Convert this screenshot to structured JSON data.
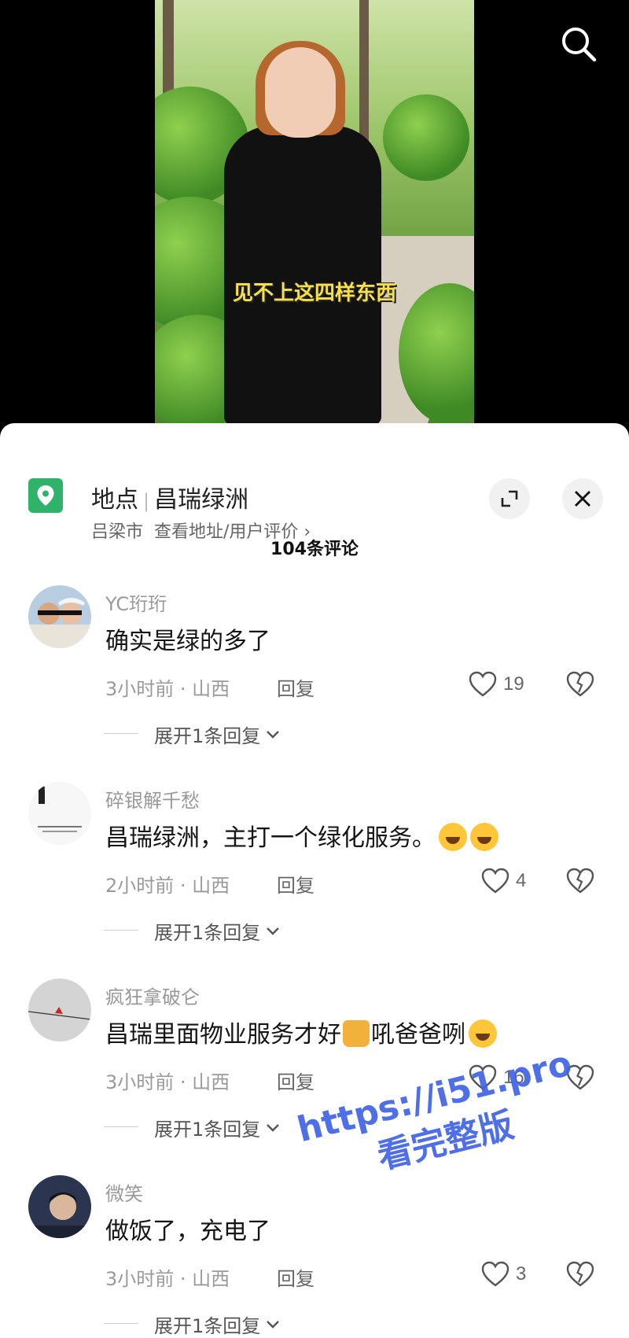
{
  "video": {
    "caption": "见不上这四样东西"
  },
  "location": {
    "label": "地点",
    "name": "昌瑞绿洲",
    "city": "吕梁市",
    "link": "查看地址/用户评价 ›"
  },
  "comment_count": "104条评论",
  "comments": [
    {
      "user": "YC珩珩",
      "text": "确实是绿的多了",
      "meta": "3小时前 · 山西",
      "reply": "回复",
      "likes": "19",
      "expand": "展开1条回复"
    },
    {
      "user": "碎银解千愁",
      "text": "昌瑞绿洲，主打一个绿化服务。",
      "meta": "2小时前 · 山西",
      "reply": "回复",
      "likes": "4",
      "expand": "展开1条回复"
    },
    {
      "user": "疯狂拿破仑",
      "text_a": "昌瑞里面物业服务才好",
      "text_b": "吼爸爸咧",
      "meta": "3小时前 · 山西",
      "reply": "回复",
      "likes": "16",
      "expand": "展开1条回复"
    },
    {
      "user": "微笑",
      "text": "做饭了，充电了",
      "meta": "3小时前 · 山西",
      "reply": "回复",
      "likes": "3",
      "expand": "展开1条回复"
    }
  ],
  "watermark": {
    "line1": "https://i51.pro",
    "line2": "看完整版"
  },
  "colors": {
    "location_icon": "#2fb36a",
    "watermark": "#3f63e6"
  },
  "icons": [
    "search-icon",
    "location-pin-icon",
    "expand-icon",
    "close-icon",
    "heart-icon",
    "broken-heart-icon",
    "chevron-down-icon"
  ]
}
